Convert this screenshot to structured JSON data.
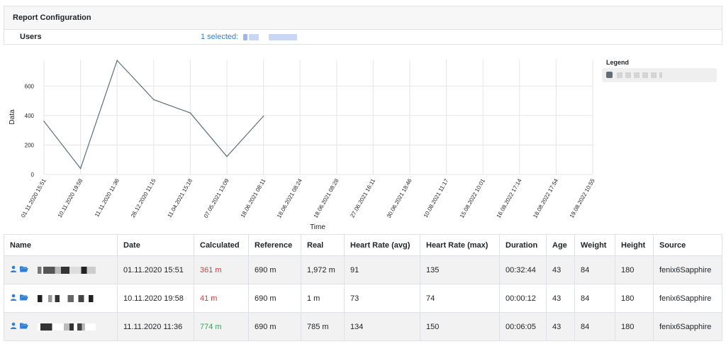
{
  "header": {
    "title": "Report Configuration"
  },
  "users": {
    "label": "Users",
    "selected_text": "1 selected:"
  },
  "legend": {
    "title": "Legend",
    "series_color": "#5f6f7a"
  },
  "chart_data": {
    "type": "line",
    "xlabel": "Time",
    "ylabel": "Data",
    "ylim": [
      0,
      780
    ],
    "yticks": [
      0,
      200,
      400,
      600
    ],
    "categories": [
      "01.11.2020 15:51",
      "10.11.2020 19:58",
      "11.11.2020 11:36",
      "26.12.2020 11:15",
      "11.04.2021 15:18",
      "07.05.2021 13:09",
      "18.06.2021 08:11",
      "18.06.2021 08:24",
      "18.06.2021 08:28",
      "27.06.2021 16:11",
      "30.06.2021 18:46",
      "10.08.2021 11:17",
      "15.08.2022 10:01",
      "16.08.2022 17:14",
      "18.08.2022 17:54",
      "19.08.2022 10:55"
    ],
    "series": [
      {
        "values": [
          361,
          41,
          774,
          508,
          418,
          122,
          396
        ],
        "color": "#5f6f7a"
      }
    ],
    "grid": true
  },
  "table": {
    "columns": [
      "Name",
      "Date",
      "Calculated",
      "Reference",
      "Real",
      "Heart Rate (avg)",
      "Heart Rate (max)",
      "Duration",
      "Age",
      "Weight",
      "Height",
      "Source"
    ],
    "rows": [
      {
        "date": "01.11.2020 15:51",
        "calculated": "361 m",
        "calc_color": "red",
        "reference": "690 m",
        "real": "1,972 m",
        "hr_avg": "91",
        "hr_max": "135",
        "duration": "00:32:44",
        "age": "43",
        "weight": "84",
        "height": "180",
        "source": "fenix6Sapphire"
      },
      {
        "date": "10.11.2020 19:58",
        "calculated": "41 m",
        "calc_color": "red",
        "reference": "690 m",
        "real": "1 m",
        "hr_avg": "73",
        "hr_max": "74",
        "duration": "00:00:12",
        "age": "43",
        "weight": "84",
        "height": "180",
        "source": "fenix6Sapphire"
      },
      {
        "date": "11.11.2020 11:36",
        "calculated": "774 m",
        "calc_color": "green",
        "reference": "690 m",
        "real": "785 m",
        "hr_avg": "134",
        "hr_max": "150",
        "duration": "00:06:05",
        "age": "43",
        "weight": "84",
        "height": "180",
        "source": "fenix6Sapphire"
      }
    ],
    "icons": {
      "user": "user-icon",
      "folder": "folder-open-icon"
    }
  }
}
